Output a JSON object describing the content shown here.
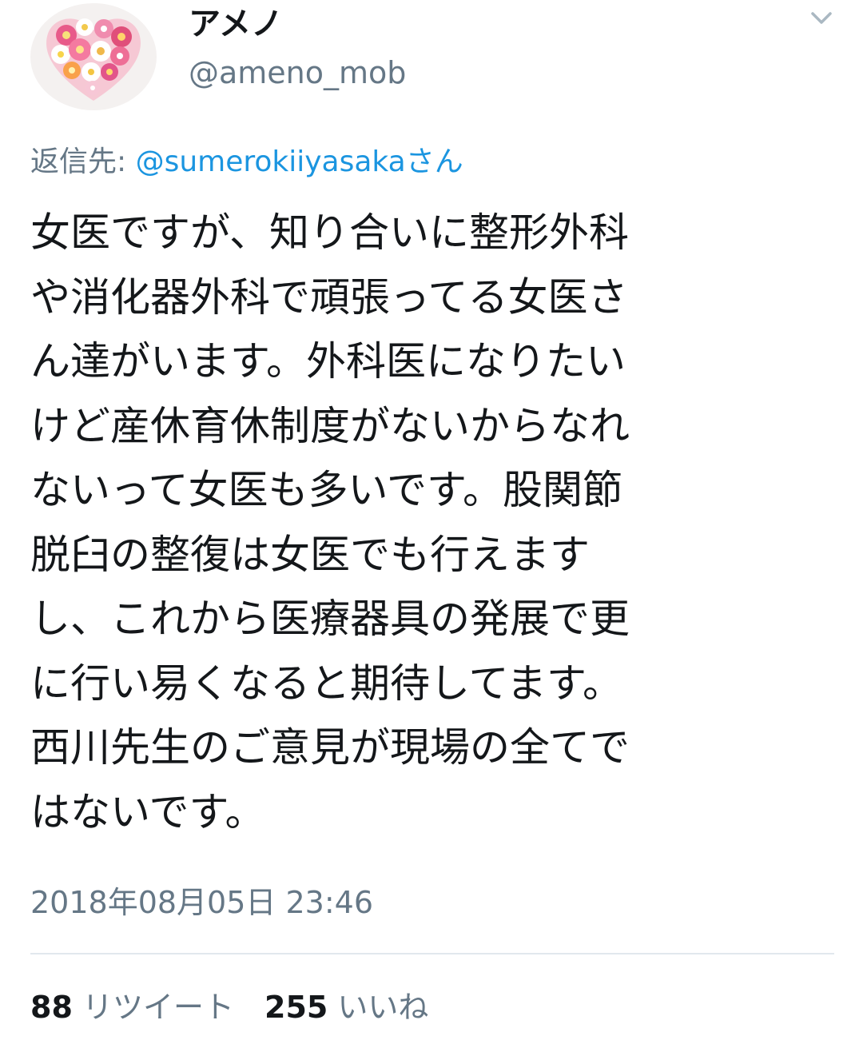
{
  "user": {
    "display_name": "アメノ",
    "handle": "@ameno_mob"
  },
  "reply": {
    "prefix": "返信先: ",
    "mention": "@sumerokiiyasaka",
    "suffix": "さん"
  },
  "tweet": {
    "lines": [
      "女医ですが、知り合いに整形外科",
      "や消化器外科で頑張ってる女医さ",
      "ん達がいます。外科医になりたい",
      "けど産休育休制度がないからなれ",
      "ないって女医も多いです。股関節",
      "脱臼の整復は女医でも行えます",
      "し、これから医療器具の発展で更",
      "に行い易くなると期待してます。",
      "西川先生のご意見が現場の全てで",
      "はないです。"
    ]
  },
  "timestamp": "2018年08月05日 23:46",
  "stats": {
    "retweets_count": "88",
    "retweets_label": "リツイート",
    "likes_count": "255",
    "likes_label": "いいね"
  },
  "icons": {
    "caret": "chevron-down-icon",
    "avatar": "flower-heart-avatar"
  },
  "colors": {
    "text": "#14171a",
    "secondary": "#657786",
    "link": "#1b95e0",
    "divider": "#e1e8ed"
  }
}
